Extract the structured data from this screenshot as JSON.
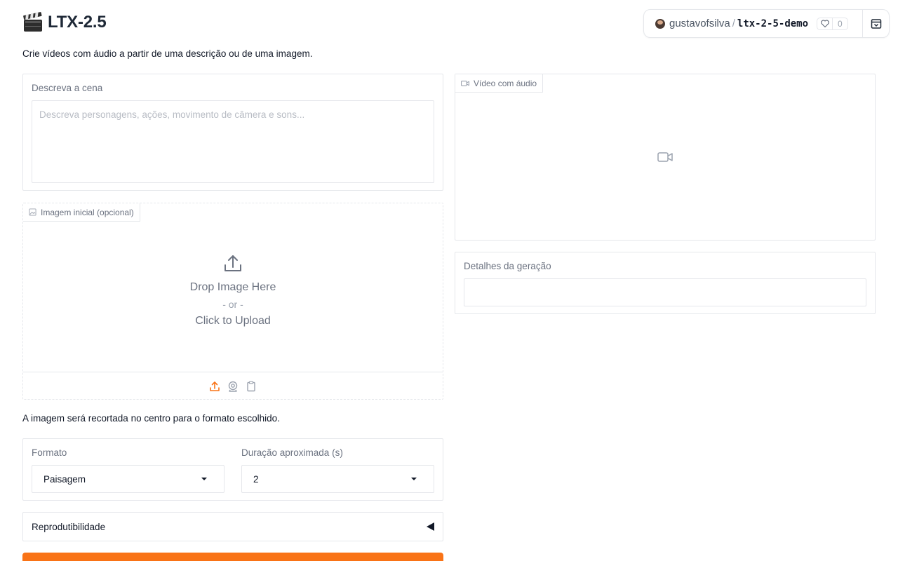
{
  "app": {
    "title": "LTX-2.5",
    "subtitle": "Crie vídeos com áudio a partir de uma descrição ou de uma imagem."
  },
  "hf_badge": {
    "user": "gustavofsilva",
    "separator": "/",
    "repo": "ltx-2-5-demo",
    "likes": "0"
  },
  "scene": {
    "label": "Descreva a cena",
    "placeholder": "Descreva personagens, ações, movimento de câmera e sons...",
    "value": ""
  },
  "image_upload": {
    "label": "Imagem inicial (opcional)",
    "drop_text": "Drop Image Here",
    "or_text": "- or -",
    "click_text": "Click to Upload",
    "sources": [
      "upload",
      "webcam",
      "clipboard"
    ],
    "active_source_color": "#f97316"
  },
  "crop_note": "A imagem será recortada no centro para o formato escolhido.",
  "format": {
    "label": "Formato",
    "value": "Paisagem"
  },
  "duration": {
    "label": "Duração aproximada (s)",
    "value": "2"
  },
  "reproducibility": {
    "label": "Reprodutibilidade"
  },
  "video_output": {
    "label": "Vídeo com áudio"
  },
  "details": {
    "label": "Detalhes da geração",
    "value": ""
  },
  "colors": {
    "accent": "#f97316",
    "border": "#e5e7eb"
  }
}
